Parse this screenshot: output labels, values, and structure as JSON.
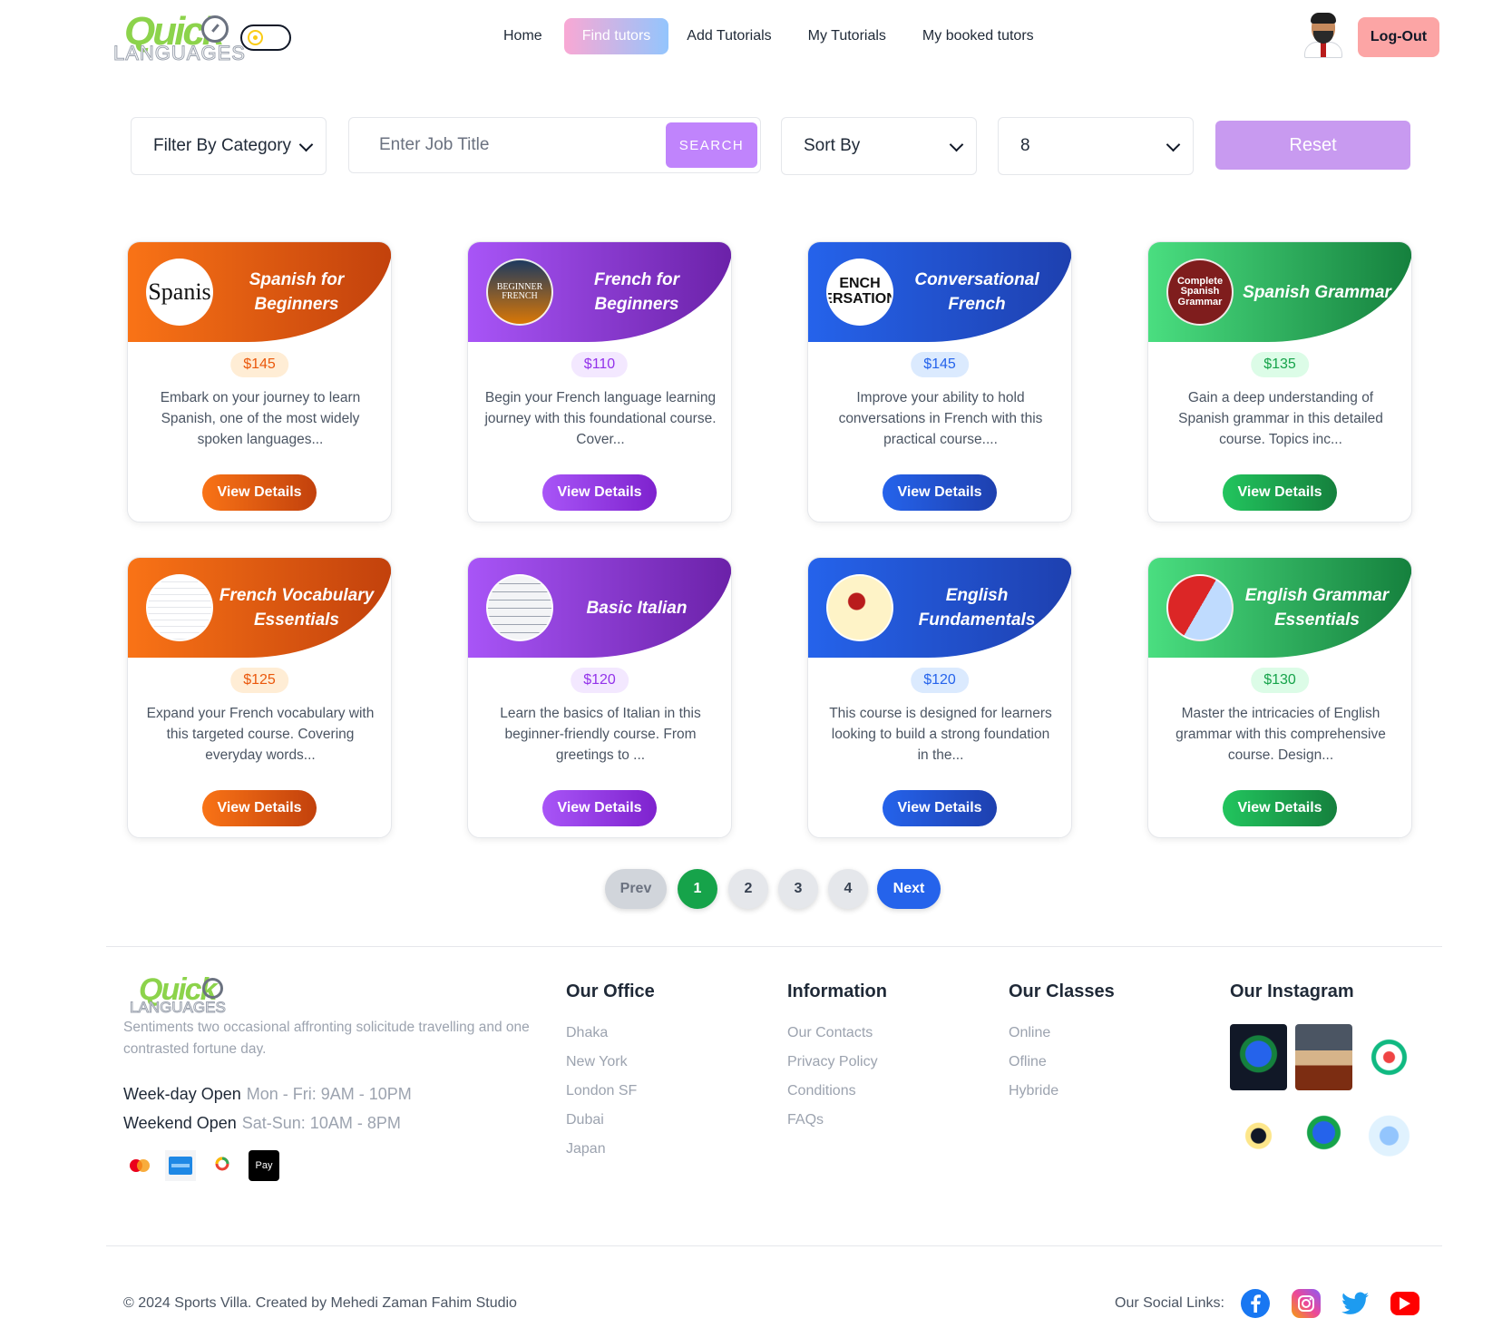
{
  "header": {
    "logo_text": "Quick",
    "logo_sub": "LANGUAGES",
    "nav": [
      {
        "label": "Home",
        "active": false
      },
      {
        "label": "Find tutors",
        "active": true
      },
      {
        "label": "Add Tutorials",
        "active": false
      },
      {
        "label": "My Tutorials",
        "active": false
      },
      {
        "label": "My booked tutors",
        "active": false
      }
    ],
    "logout_label": "Log-Out"
  },
  "filters": {
    "category_label": "Filter By Category",
    "search_placeholder": "Enter Job Title",
    "search_button": "SEARCH",
    "sort_label": "Sort By",
    "per_page_value": "8",
    "reset_label": "Reset"
  },
  "cards": [
    {
      "title": "Spanish for Beginners",
      "price": "$145",
      "description": "Embark on your journey to learn Spanish, one of the most widely spoken languages...",
      "button": "View Details",
      "thumb_text": "Spanis"
    },
    {
      "title": "French for Beginners",
      "price": "$110",
      "description": "Begin your French language learning journey with this foundational course. Cover...",
      "button": "View Details",
      "thumb_text": "BEGINNER FRENCH"
    },
    {
      "title": "Conversational French",
      "price": "$145",
      "description": "Improve your ability to hold conversations in French with this practical course....",
      "button": "View Details",
      "thumb_text": "ENCH ERSATION"
    },
    {
      "title": "Spanish Grammar",
      "price": "$135",
      "description": "Gain a deep understanding of Spanish grammar in this detailed course. Topics inc...",
      "button": "View Details",
      "thumb_text": "Complete Spanish Grammar"
    },
    {
      "title": "French Vocabulary Essentials",
      "price": "$125",
      "description": "Expand your French vocabulary with this targeted course. Covering everyday words...",
      "button": "View Details",
      "thumb_text": ""
    },
    {
      "title": "Basic Italian",
      "price": "$120",
      "description": "Learn the basics of Italian in this beginner-friendly course. From greetings to ...",
      "button": "View Details",
      "thumb_text": ""
    },
    {
      "title": "English Fundamentals",
      "price": "$120",
      "description": "This course is designed for learners looking to build a strong foundation in the...",
      "button": "View Details",
      "thumb_text": ""
    },
    {
      "title": "English Grammar Essentials",
      "price": "$130",
      "description": "Master the intricacies of English grammar with this comprehensive course. Design...",
      "button": "View Details",
      "thumb_text": ""
    }
  ],
  "pagination": {
    "prev": "Prev",
    "pages": [
      "1",
      "2",
      "3",
      "4"
    ],
    "current": "1",
    "next": "Next"
  },
  "footer": {
    "tagline": "Sentiments two occasional affronting solicitude travelling and one contrasted fortune day.",
    "hours": [
      {
        "label": "Week-day Open",
        "value": "Mon - Fri: 9AM - 10PM"
      },
      {
        "label": "Weekend Open",
        "value": "Sat-Sun: 10AM - 8PM"
      }
    ],
    "payment_icons": [
      "mastercard-icon",
      "amex-icon",
      "google-pay-icon",
      "apple-pay-icon"
    ],
    "apple_pay_text": "Pay",
    "office": {
      "title": "Our Office",
      "items": [
        "Dhaka",
        "New York",
        "London SF",
        "Dubai",
        "Japan"
      ]
    },
    "information": {
      "title": "Information",
      "items": [
        "Our Contacts",
        "Privacy Policy",
        "Conditions",
        "FAQs"
      ]
    },
    "classes": {
      "title": "Our Classes",
      "items": [
        "Online",
        "Ofline",
        "Hybride"
      ]
    },
    "instagram": {
      "title": "Our Instagram"
    },
    "copyright": "© 2024 Sports Villa. Created by Mehedi Zaman Fahim Studio",
    "social_label": "Our Social Links:",
    "social": [
      "facebook-icon",
      "instagram-icon",
      "twitter-icon",
      "youtube-icon"
    ]
  },
  "colors": {
    "orange": "#f97316",
    "purple": "#a855f7",
    "blue": "#2563eb",
    "green": "#22c55e",
    "logout": "#fca5a5",
    "reset": "#c89af0"
  }
}
